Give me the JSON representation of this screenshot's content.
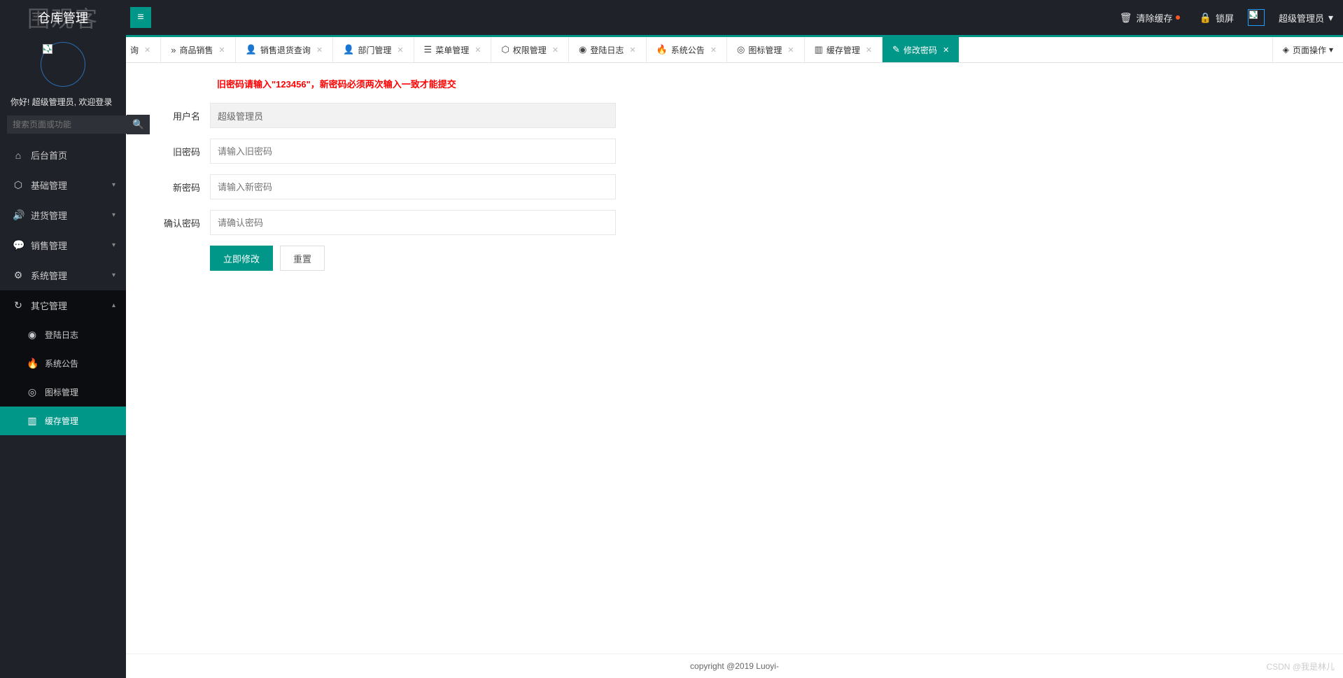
{
  "app": {
    "title": "仓库管理",
    "watermark": "围观客"
  },
  "sidebar": {
    "welcome_prefix": "你好! ",
    "welcome_user": "超级管理员",
    "welcome_suffix": ", 欢迎登录",
    "search_placeholder": "搜索页面或功能",
    "items": [
      {
        "label": "后台首页",
        "icon": "home-icon",
        "has_children": false
      },
      {
        "label": "基础管理",
        "icon": "cube-icon",
        "has_children": true
      },
      {
        "label": "进货管理",
        "icon": "speaker-icon",
        "has_children": true
      },
      {
        "label": "销售管理",
        "icon": "chat-icon",
        "has_children": true
      },
      {
        "label": "系统管理",
        "icon": "gear-icon",
        "has_children": true
      },
      {
        "label": "其它管理",
        "icon": "refresh-icon",
        "has_children": true,
        "expanded": true,
        "children": [
          {
            "label": "登陆日志",
            "icon": "share-icon"
          },
          {
            "label": "系统公告",
            "icon": "fire-icon"
          },
          {
            "label": "图标管理",
            "icon": "compass-icon"
          },
          {
            "label": "缓存管理",
            "icon": "layers-icon",
            "active": true
          }
        ]
      }
    ]
  },
  "header": {
    "clear_cache": "清除缓存",
    "lock": "锁屏",
    "user": "超级管理员"
  },
  "tabs": {
    "truncated_first": "询",
    "items": [
      {
        "label": "商品销售",
        "icon": "forward-icon"
      },
      {
        "label": "销售退货查询",
        "icon": "user-icon"
      },
      {
        "label": "部门管理",
        "icon": "user-icon"
      },
      {
        "label": "菜单管理",
        "icon": "list-icon"
      },
      {
        "label": "权限管理",
        "icon": "cube-icon"
      },
      {
        "label": "登陆日志",
        "icon": "share-icon"
      },
      {
        "label": "系统公告",
        "icon": "fire-icon"
      },
      {
        "label": "图标管理",
        "icon": "compass-icon"
      },
      {
        "label": "缓存管理",
        "icon": "layers-icon"
      },
      {
        "label": "修改密码",
        "icon": "edit-icon",
        "active": true
      }
    ],
    "page_ops": "页面操作"
  },
  "form": {
    "hint": "旧密码请输入\"123456\"，新密码必须两次输入一致才能提交",
    "username_label": "用户名",
    "username_value": "超级管理员",
    "old_pwd_label": "旧密码",
    "old_pwd_placeholder": "请输入旧密码",
    "new_pwd_label": "新密码",
    "new_pwd_placeholder": "请输入新密码",
    "confirm_pwd_label": "确认密码",
    "confirm_pwd_placeholder": "请确认密码",
    "submit": "立即修改",
    "reset": "重置"
  },
  "footer": "copyright @2019 Luoyi-",
  "csdn": "CSDN @我是林儿"
}
